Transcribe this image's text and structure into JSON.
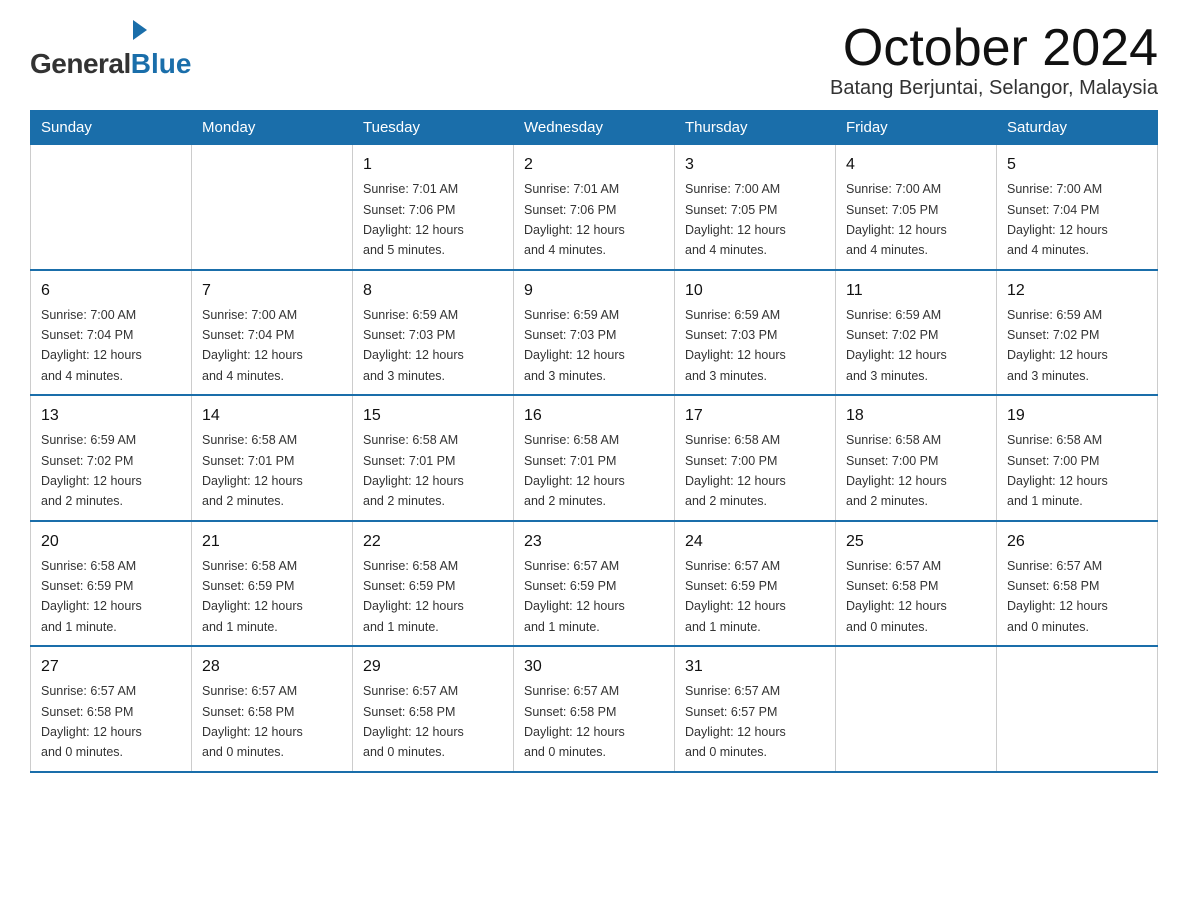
{
  "logo": {
    "general": "General",
    "blue": "Blue"
  },
  "title": "October 2024",
  "subtitle": "Batang Berjuntai, Selangor, Malaysia",
  "weekdays": [
    "Sunday",
    "Monday",
    "Tuesday",
    "Wednesday",
    "Thursday",
    "Friday",
    "Saturday"
  ],
  "weeks": [
    [
      null,
      null,
      {
        "day": "1",
        "sunrise": "7:01 AM",
        "sunset": "7:06 PM",
        "daylight": "12 hours and 5 minutes."
      },
      {
        "day": "2",
        "sunrise": "7:01 AM",
        "sunset": "7:06 PM",
        "daylight": "12 hours and 4 minutes."
      },
      {
        "day": "3",
        "sunrise": "7:00 AM",
        "sunset": "7:05 PM",
        "daylight": "12 hours and 4 minutes."
      },
      {
        "day": "4",
        "sunrise": "7:00 AM",
        "sunset": "7:05 PM",
        "daylight": "12 hours and 4 minutes."
      },
      {
        "day": "5",
        "sunrise": "7:00 AM",
        "sunset": "7:04 PM",
        "daylight": "12 hours and 4 minutes."
      }
    ],
    [
      {
        "day": "6",
        "sunrise": "7:00 AM",
        "sunset": "7:04 PM",
        "daylight": "12 hours and 4 minutes."
      },
      {
        "day": "7",
        "sunrise": "7:00 AM",
        "sunset": "7:04 PM",
        "daylight": "12 hours and 4 minutes."
      },
      {
        "day": "8",
        "sunrise": "6:59 AM",
        "sunset": "7:03 PM",
        "daylight": "12 hours and 3 minutes."
      },
      {
        "day": "9",
        "sunrise": "6:59 AM",
        "sunset": "7:03 PM",
        "daylight": "12 hours and 3 minutes."
      },
      {
        "day": "10",
        "sunrise": "6:59 AM",
        "sunset": "7:03 PM",
        "daylight": "12 hours and 3 minutes."
      },
      {
        "day": "11",
        "sunrise": "6:59 AM",
        "sunset": "7:02 PM",
        "daylight": "12 hours and 3 minutes."
      },
      {
        "day": "12",
        "sunrise": "6:59 AM",
        "sunset": "7:02 PM",
        "daylight": "12 hours and 3 minutes."
      }
    ],
    [
      {
        "day": "13",
        "sunrise": "6:59 AM",
        "sunset": "7:02 PM",
        "daylight": "12 hours and 2 minutes."
      },
      {
        "day": "14",
        "sunrise": "6:58 AM",
        "sunset": "7:01 PM",
        "daylight": "12 hours and 2 minutes."
      },
      {
        "day": "15",
        "sunrise": "6:58 AM",
        "sunset": "7:01 PM",
        "daylight": "12 hours and 2 minutes."
      },
      {
        "day": "16",
        "sunrise": "6:58 AM",
        "sunset": "7:01 PM",
        "daylight": "12 hours and 2 minutes."
      },
      {
        "day": "17",
        "sunrise": "6:58 AM",
        "sunset": "7:00 PM",
        "daylight": "12 hours and 2 minutes."
      },
      {
        "day": "18",
        "sunrise": "6:58 AM",
        "sunset": "7:00 PM",
        "daylight": "12 hours and 2 minutes."
      },
      {
        "day": "19",
        "sunrise": "6:58 AM",
        "sunset": "7:00 PM",
        "daylight": "12 hours and 1 minute."
      }
    ],
    [
      {
        "day": "20",
        "sunrise": "6:58 AM",
        "sunset": "6:59 PM",
        "daylight": "12 hours and 1 minute."
      },
      {
        "day": "21",
        "sunrise": "6:58 AM",
        "sunset": "6:59 PM",
        "daylight": "12 hours and 1 minute."
      },
      {
        "day": "22",
        "sunrise": "6:58 AM",
        "sunset": "6:59 PM",
        "daylight": "12 hours and 1 minute."
      },
      {
        "day": "23",
        "sunrise": "6:57 AM",
        "sunset": "6:59 PM",
        "daylight": "12 hours and 1 minute."
      },
      {
        "day": "24",
        "sunrise": "6:57 AM",
        "sunset": "6:59 PM",
        "daylight": "12 hours and 1 minute."
      },
      {
        "day": "25",
        "sunrise": "6:57 AM",
        "sunset": "6:58 PM",
        "daylight": "12 hours and 0 minutes."
      },
      {
        "day": "26",
        "sunrise": "6:57 AM",
        "sunset": "6:58 PM",
        "daylight": "12 hours and 0 minutes."
      }
    ],
    [
      {
        "day": "27",
        "sunrise": "6:57 AM",
        "sunset": "6:58 PM",
        "daylight": "12 hours and 0 minutes."
      },
      {
        "day": "28",
        "sunrise": "6:57 AM",
        "sunset": "6:58 PM",
        "daylight": "12 hours and 0 minutes."
      },
      {
        "day": "29",
        "sunrise": "6:57 AM",
        "sunset": "6:58 PM",
        "daylight": "12 hours and 0 minutes."
      },
      {
        "day": "30",
        "sunrise": "6:57 AM",
        "sunset": "6:58 PM",
        "daylight": "12 hours and 0 minutes."
      },
      {
        "day": "31",
        "sunrise": "6:57 AM",
        "sunset": "6:57 PM",
        "daylight": "12 hours and 0 minutes."
      },
      null,
      null
    ]
  ],
  "labels": {
    "sunrise": "Sunrise:",
    "sunset": "Sunset:",
    "daylight": "Daylight:"
  }
}
